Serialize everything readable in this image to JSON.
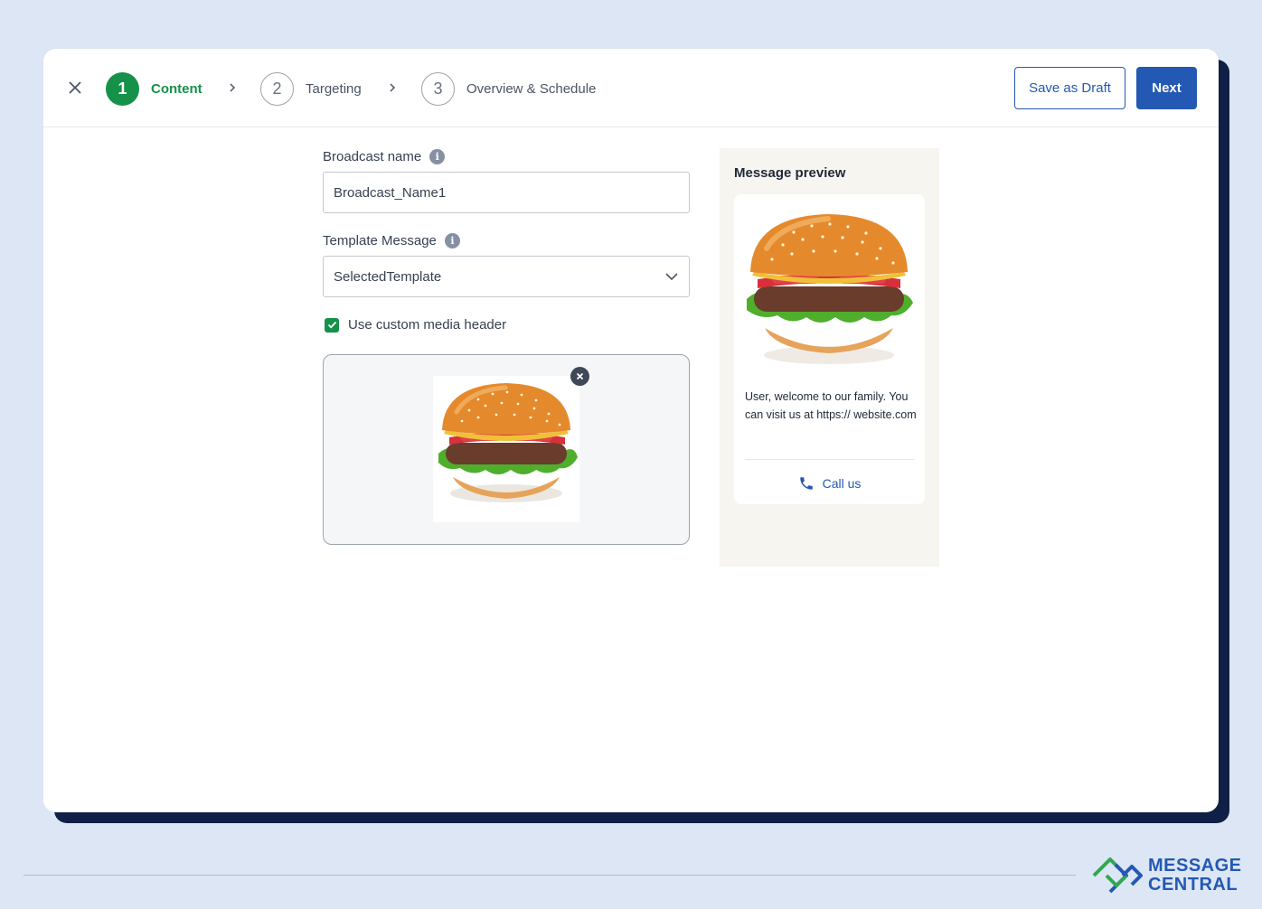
{
  "header": {
    "steps": [
      {
        "number": "1",
        "label": "Content",
        "state": "active"
      },
      {
        "number": "2",
        "label": "Targeting",
        "state": "inactive"
      },
      {
        "number": "3",
        "label": "Overview & Schedule",
        "state": "inactive"
      }
    ],
    "save_draft_label": "Save as Draft",
    "next_label": "Next"
  },
  "form": {
    "broadcast_name_label": "Broadcast name",
    "broadcast_name_value": "Broadcast_Name1",
    "template_label": "Template Message",
    "template_value": "SelectedTemplate",
    "custom_media_label": "Use custom media header",
    "custom_media_checked": true
  },
  "preview": {
    "title": "Message preview",
    "message": "User, welcome to our family. You can visit us at https:// website.com",
    "call_label": "Call us"
  },
  "brand": {
    "line1": "MESSAGE",
    "line2": "CENTRAL"
  },
  "colors": {
    "primary": "#2459b3",
    "success": "#16914a",
    "navy": "#0f1f45",
    "background": "#dce6f4"
  }
}
